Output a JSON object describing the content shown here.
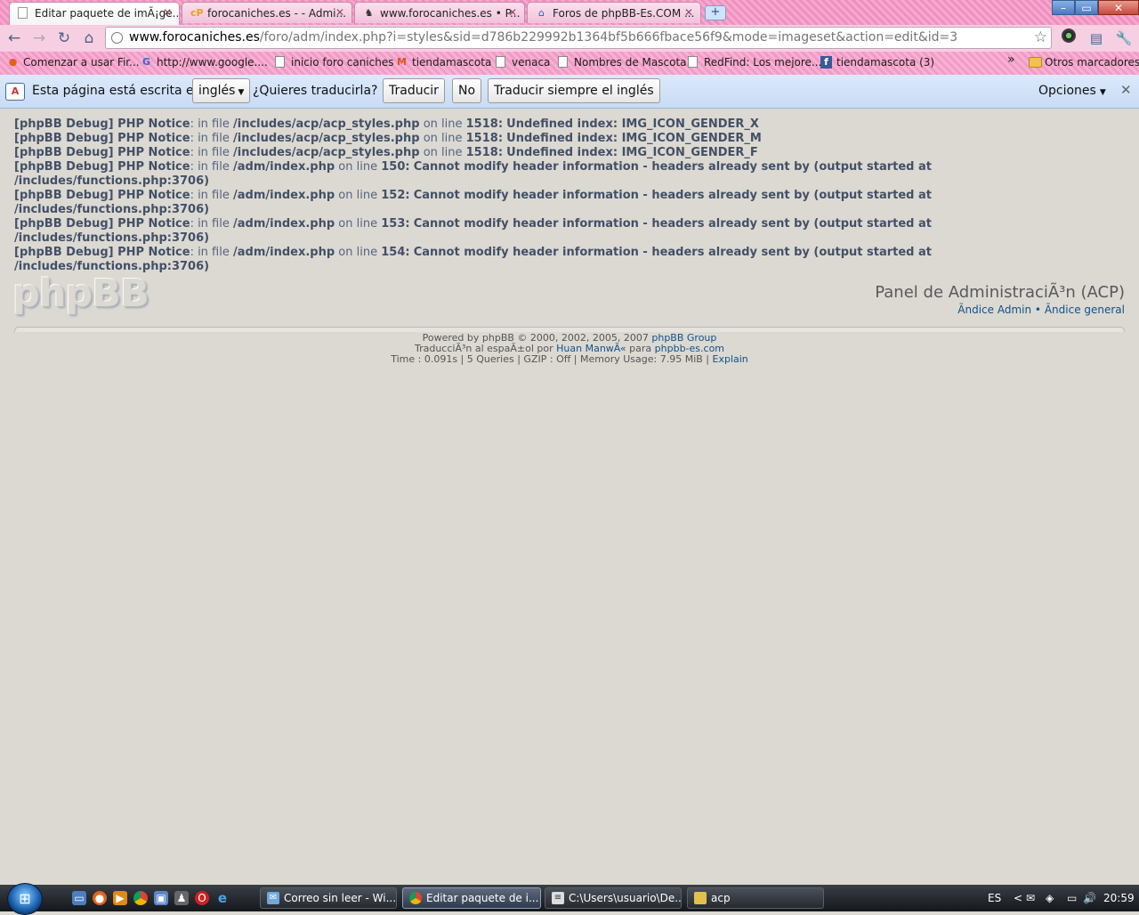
{
  "browser": {
    "tabs": [
      {
        "title": "Editar paquete de imÃ¡ge...",
        "active": true
      },
      {
        "title": "forocaniches.es - - Admi...",
        "active": false
      },
      {
        "title": "www.forocaniches.es • P...",
        "active": false
      },
      {
        "title": "Foros de phpBB-Es.COM ...",
        "active": false
      }
    ],
    "new_tab_label": "+",
    "window_buttons": {
      "minimize": "–",
      "maximize": "▭",
      "close": "✕"
    }
  },
  "toolbar": {
    "url_host": "www.forocaniches.es",
    "url_path": "/foro/adm/index.php?i=styles&sid=d786b229992b1364bf5b666fbace56f9&mode=imageset&action=edit&id=3",
    "back": "←",
    "forward": "→",
    "reload": "↻",
    "home": "⌂",
    "star": "☆",
    "wrench": "🔧"
  },
  "bookmarks": {
    "items": [
      {
        "label": "Comenzar a usar Fir...",
        "icon": "firefox-icon"
      },
      {
        "label": "http://www.google....",
        "icon": "google-icon"
      },
      {
        "label": "inicio foro caniches",
        "icon": "page-icon"
      },
      {
        "label": "tiendamascota",
        "icon": "magento-icon"
      },
      {
        "label": "venaca",
        "icon": "page-icon"
      },
      {
        "label": "Nombres de Mascota",
        "icon": "page-icon"
      },
      {
        "label": "RedFind: Los mejore...",
        "icon": "page-icon"
      },
      {
        "label": "tiendamascota (3)",
        "icon": "facebook-icon"
      }
    ],
    "overflow": "»",
    "other": "Otros marcadores"
  },
  "infobar": {
    "prefix": "Esta página está escrita en",
    "language": "inglés",
    "question": "¿Quieres traducirla?",
    "translate": "Traducir",
    "no": "No",
    "always": "Traducir siempre el inglés",
    "options": "Opciones",
    "close": "✕"
  },
  "debug_lines": [
    {
      "tag": "[phpBB Debug] PHP Notice",
      "file": "/includes/acp/acp_styles.php",
      "line": "1518",
      "msg": "Undefined index: IMG_ICON_GENDER_X"
    },
    {
      "tag": "[phpBB Debug] PHP Notice",
      "file": "/includes/acp/acp_styles.php",
      "line": "1518",
      "msg": "Undefined index: IMG_ICON_GENDER_M"
    },
    {
      "tag": "[phpBB Debug] PHP Notice",
      "file": "/includes/acp/acp_styles.php",
      "line": "1518",
      "msg": "Undefined index: IMG_ICON_GENDER_F"
    },
    {
      "tag": "[phpBB Debug] PHP Notice",
      "file": "/adm/index.php",
      "line": "150",
      "msg": "Cannot modify header information - headers already sent by (output started at /includes/functions.php:3706)"
    },
    {
      "tag": "[phpBB Debug] PHP Notice",
      "file": "/adm/index.php",
      "line": "152",
      "msg": "Cannot modify header information - headers already sent by (output started at /includes/functions.php:3706)"
    },
    {
      "tag": "[phpBB Debug] PHP Notice",
      "file": "/adm/index.php",
      "line": "153",
      "msg": "Cannot modify header information - headers already sent by (output started at /includes/functions.php:3706)"
    },
    {
      "tag": "[phpBB Debug] PHP Notice",
      "file": "/adm/index.php",
      "line": "154",
      "msg": "Cannot modify header information - headers already sent by (output started at /includes/functions.php:3706)"
    }
  ],
  "debug_words": {
    "in_file": ": in file",
    "on_line": "on line"
  },
  "acp": {
    "logo": "phpBB",
    "title": "Panel de AdministraciÃ³n (ACP)",
    "link_admin": "Ãndice Admin",
    "separator": "•",
    "link_general": "Ãndice general"
  },
  "footer": {
    "powered": "Powered by phpBB © 2000, 2002, 2005, 2007",
    "powered_link": "phpBB Group",
    "translation_prefix": "TraducciÃ³n al espaÃ±ol por",
    "translator": "Huan ManwÃ«",
    "translation_mid": "para",
    "translation_site": "phpbb-es.com",
    "stats": "Time : 0.091s | 5 Queries | GZIP : Off | Memory Usage: 7.95 MiB |",
    "explain": "Explain"
  },
  "taskbar": {
    "tasks": [
      {
        "label": "Correo sin leer - Wi...",
        "active": false
      },
      {
        "label": "Editar paquete de i...",
        "active": true
      },
      {
        "label": "C:\\Users\\usuario\\De...",
        "active": false
      },
      {
        "label": "acp",
        "active": false
      }
    ],
    "lang": "ES",
    "tray_arrow": "<",
    "clock": "20:59"
  }
}
